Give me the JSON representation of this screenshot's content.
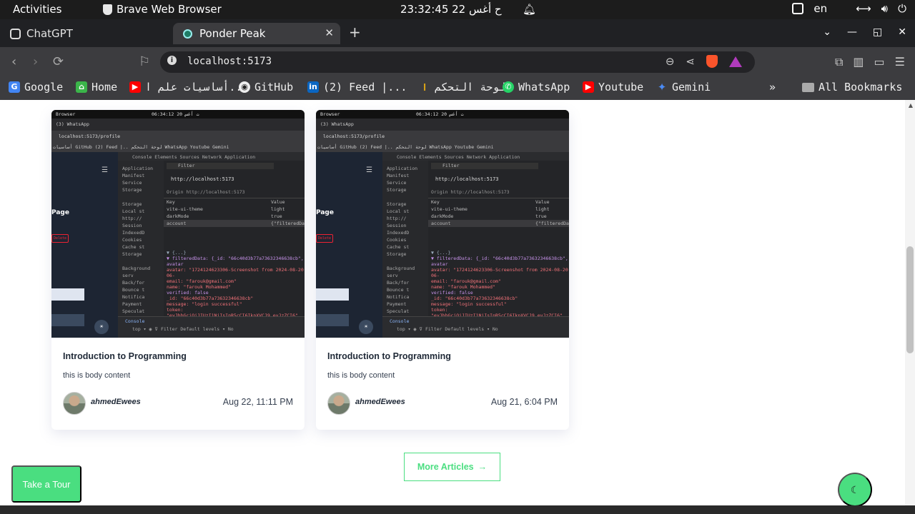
{
  "system_bar": {
    "activities": "Activities",
    "app_name": "Brave Web Browser",
    "clock": "23:32:45 22 ح أغس",
    "language": "en"
  },
  "tabs": [
    {
      "label": "ChatGPT",
      "active": false
    },
    {
      "label": "Ponder Peak",
      "active": true
    }
  ],
  "address_bar": {
    "url": "localhost:5173"
  },
  "bookmarks": [
    {
      "label": "Google",
      "icon": "google-icon",
      "color": "#4285f4"
    },
    {
      "label": "Home",
      "icon": "home-icon",
      "color": "#3bb54a"
    },
    {
      "label": "أساسيات علم ا...",
      "icon": "youtube-icon",
      "color": "#ff0000"
    },
    {
      "label": "GitHub",
      "icon": "github-icon",
      "color": "#eeeeee"
    },
    {
      "label": "(2) Feed |...",
      "icon": "linkedin-icon",
      "color": "#0a66c2"
    },
    {
      "label": "لوحة التحكم",
      "icon": "torch-icon",
      "color": "#d4a017"
    },
    {
      "label": "WhatsApp",
      "icon": "whatsapp-icon",
      "color": "#25d366"
    },
    {
      "label": "Youtube",
      "icon": "youtube-icon",
      "color": "#ff0000"
    },
    {
      "label": "Gemini",
      "icon": "gemini-icon",
      "color": "#4b8bf5"
    }
  ],
  "all_bookmarks": "All Bookmarks",
  "thumbnail": {
    "browser_label": "Browser",
    "clock": "06:34:12 20 ت أغس",
    "tab_label": "(3) WhatsApp",
    "url": "localhost:5173/profile",
    "bookmarks_text": "أساسيات  GitHub  (2) Feed |..  لوحة التحكم  WhatsApp  Youtube  Gemini",
    "devtools_tabs": "Console   Elements   Sources   Network   Application",
    "sidebar_lines": [
      "Application",
      "  Manifest",
      "  Service",
      "  Storage",
      "",
      "Storage",
      " Local st",
      "   http://",
      " Session",
      " IndexedD",
      " Cookies",
      " Cache st",
      " Storage",
      "",
      "Background serv",
      " Back/for",
      " Bounce t",
      " Notifica",
      " Payment",
      " Speculat"
    ],
    "filter_placeholder": "Filter",
    "origin_title": "http://localhost:5173",
    "origin_line": "Origin  http://localhost:5173",
    "kv_header_key": "Key",
    "kv_header_value": "Value",
    "kv_rows": [
      {
        "key": "vite-ui-theme",
        "value": "light"
      },
      {
        "key": "darkMode",
        "value": "true"
      },
      {
        "key": "account",
        "value": "{\"filteredData\""
      }
    ],
    "json_lines": [
      "▼ {...}",
      "  ▼ filteredData: {_id: \"66c40d3b77a73632346638cb\", avatar",
      "      avatar: \"1724124623306-Screenshot from 2024-08-20 06-",
      "      email: \"farouk@gmail.com\"",
      "      name: \"farouk Mohammed\"",
      "      verified: false",
      "      _id: \"66c40d3b77a73632346638cb\"",
      "    message: \"login successful\"",
      "    token: \"eyJhbGciOiJIUzI1NiIsInR5cCI6IkpXVCJ9.eyJzZCI6\""
    ],
    "console_tab": "Console",
    "console_bar": "top ▾   ◉   ⊽ Filter            Default levels ▾   No",
    "page_title": "Page",
    "delete_label": "Delete"
  },
  "articles": [
    {
      "title": "Introduction to Programming",
      "body": "this is body content",
      "author": "ahmedEwees",
      "date": "Aug 22, 11:11 PM"
    },
    {
      "title": "Introduction to Programming",
      "body": "this is body content",
      "author": "ahmedEwees",
      "date": "Aug 21, 6:04 PM"
    }
  ],
  "more_articles": "More Articles",
  "take_tour": "Take a Tour",
  "colors": {
    "accent": "#4ade80",
    "title": "#1f2937"
  }
}
